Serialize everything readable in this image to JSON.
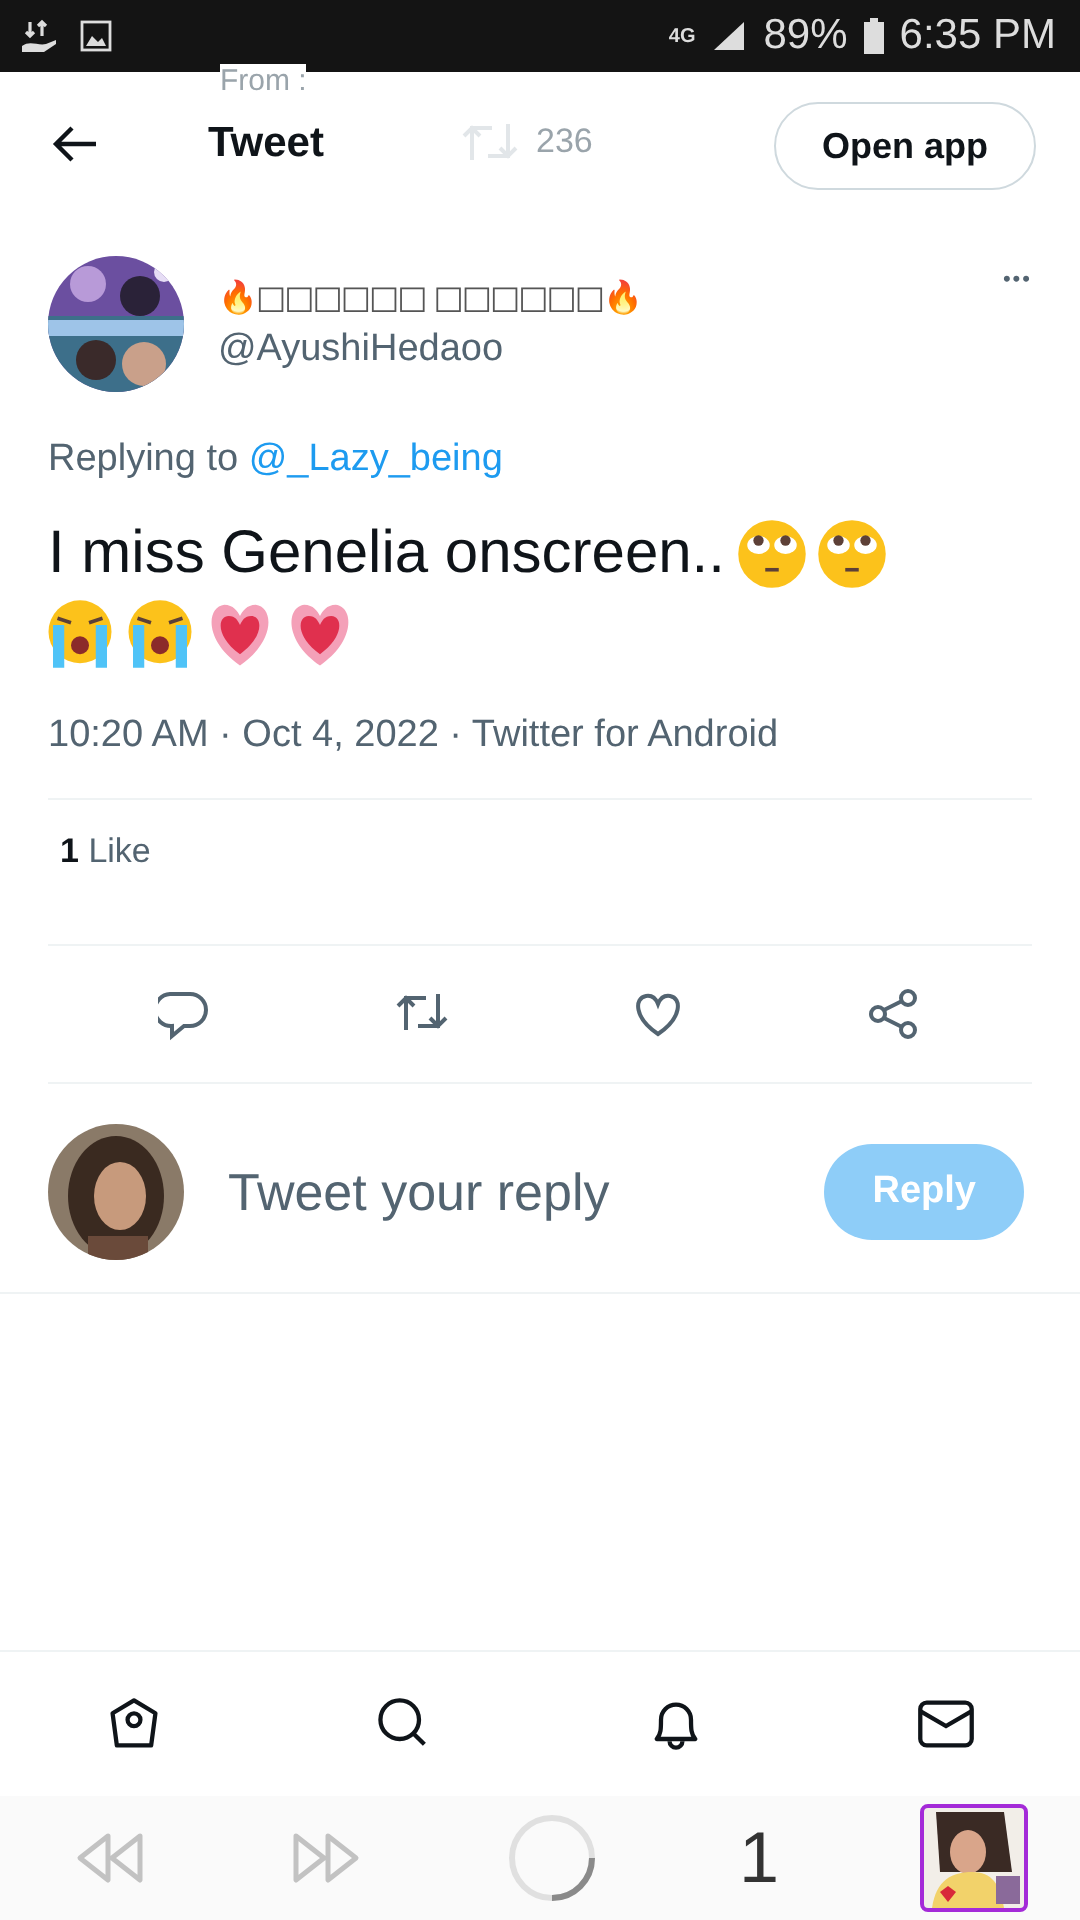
{
  "status_bar": {
    "network": "4G",
    "battery": "89%",
    "time": "6:35 PM"
  },
  "header": {
    "title": "Tweet",
    "button": "Open app",
    "behind": {
      "from": "From :",
      "retweets": "236"
    }
  },
  "tweet": {
    "name": "🔥□□□□□□ □□□□□□🔥",
    "handle": "@AyushiHedaoo",
    "more": "•••",
    "replying_prefix": "Replying to",
    "replying_to": "@_Lazy_being",
    "text": "I miss Genelia onscreen..",
    "emojis": [
      {
        "kind": "eyeroll"
      },
      {
        "kind": "eyeroll"
      },
      {
        "kind": "crying"
      },
      {
        "kind": "crying"
      },
      {
        "kind": "heart"
      },
      {
        "kind": "heart"
      }
    ],
    "time": "10:20 AM · Oct 4, 2022 · Twitter for Android",
    "likes_count": "1",
    "likes_label": "Like",
    "actions": [
      {
        "kind": "reply"
      },
      {
        "kind": "retweet"
      },
      {
        "kind": "like"
      },
      {
        "kind": "share"
      }
    ]
  },
  "reply_box": {
    "placeholder": "Tweet your reply",
    "button": "Reply",
    "disabled": true
  },
  "bottom_nav": [
    {
      "kind": "home"
    },
    {
      "kind": "search"
    },
    {
      "kind": "notifications"
    },
    {
      "kind": "messages"
    }
  ],
  "browser_bar": {
    "tabs_count": "1"
  }
}
